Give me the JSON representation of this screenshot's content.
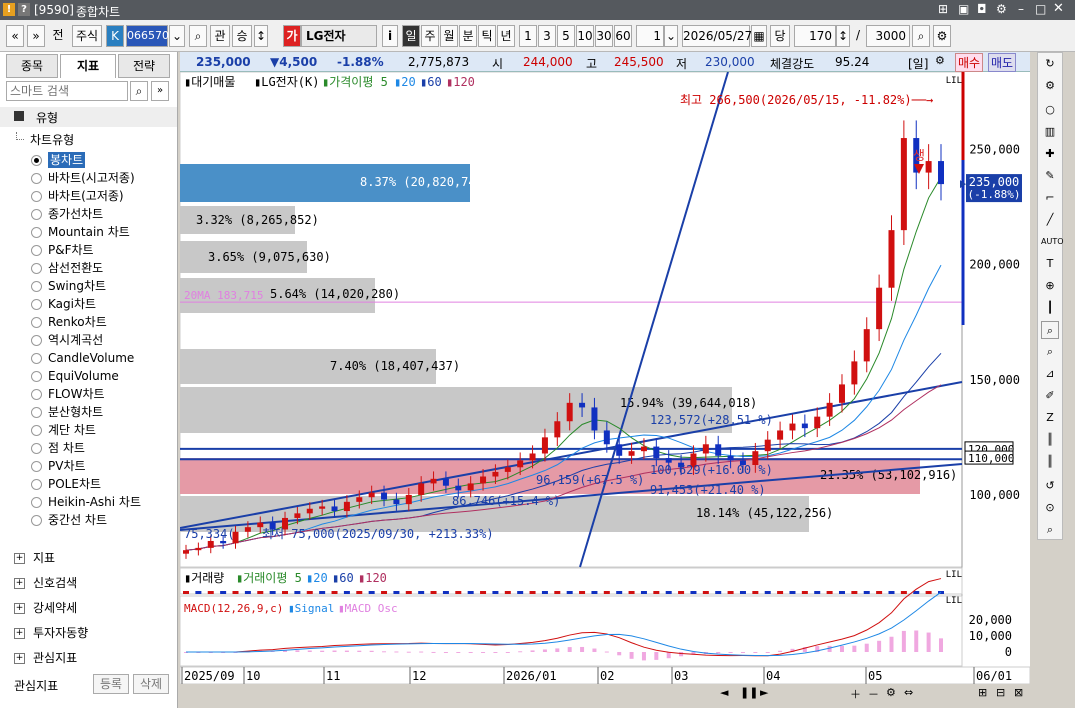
{
  "window": {
    "code": "[9590]",
    "title": "종합차트"
  },
  "toolbar": {
    "nav1": "«",
    "nav2": "»",
    "front": "전",
    "type": "주식",
    "kmark": "K",
    "code": "066570",
    "search": "⌕",
    "gwan": "관",
    "seung": "승",
    "stock_badge": "가",
    "stock_name": "LG전자",
    "info": "i",
    "periods": [
      "일",
      "주",
      "월",
      "분",
      "틱",
      "년"
    ],
    "nums": [
      "1",
      "3",
      "5",
      "10",
      "30",
      "60"
    ],
    "unit": "1",
    "date": "2026/05/27",
    "dang": "당",
    "count": "170",
    "slash": "/",
    "total": "3000"
  },
  "left": {
    "tabs": [
      "종목",
      "지표",
      "전략"
    ],
    "search_ph": "스마트 검색",
    "section_type": "유형",
    "chart_type_label": "차트유형",
    "types": [
      "봉차트",
      "바차트(시고저종)",
      "바차트(고저종)",
      "종가선차트",
      "Mountain 차트",
      "P&F차트",
      "삼선전환도",
      "Swing차트",
      "Kagi차트",
      "Renko차트",
      "역시계곡선",
      "CandleVolume",
      "EquiVolume",
      "FLOW차트",
      "분산형차트",
      "계단 차트",
      "점 차트",
      "PV차트",
      "POLE차트",
      "Heikin-Ashi 차트",
      "중간선 차트"
    ],
    "groups": [
      "지표",
      "신호검색",
      "강세약세",
      "투자자동향",
      "관심지표"
    ],
    "bottom": {
      "label": "관심지표",
      "reg": "등록",
      "del": "삭제"
    }
  },
  "quote": {
    "price": "235,000",
    "change": "▼4,500",
    "pct": "-1.88%",
    "volume": "2,775,873",
    "open_label": "시",
    "open": "244,000",
    "high_label": "고",
    "high": "245,500",
    "low_label": "저",
    "low": "230,000",
    "strength_label": "체결강도",
    "strength": "95.24",
    "period": "[일]",
    "buy": "매수",
    "sell": "매도"
  },
  "chart_data": {
    "type": "candlestick",
    "legend": {
      "main": "대기매물",
      "name": "LG전자(K)",
      "ma": "가격이평 5",
      "ma2": "20",
      "ma3": "60",
      "ma4": "120"
    },
    "y_ticks": [
      "250,000",
      "200,000",
      "150,000",
      "120,000",
      "110,000",
      "100,000"
    ],
    "x_ticks": [
      "2025/09",
      "10",
      "11",
      "12",
      "2026/01",
      "02",
      "03",
      "04",
      "05",
      "06/01"
    ],
    "current": "235,000",
    "current_pct": "(-1.88%)",
    "high_note": "최고 266,500(2026/05/15, -11.82%)",
    "low_note": "최저 75,000(2025/09/30, +213.33%)",
    "ma20_note": "20MA 183,715",
    "ref_left": "75,334(",
    "overlay_labels": [
      "8.37% (20,820,742)",
      "3.32% (8,265,852)",
      "3.65% (9,075,630)",
      "5.64% (14,020,280)",
      "7.40% (18,407,437)",
      "15.94% (39,644,018)",
      "21.35% (53,102,916)",
      "18.14% (45,122,256)"
    ],
    "fib_labels": [
      "123,572(+28.51 %)",
      "100,629(+16.00 %)",
      "91,453(+21.40 %)",
      "86,746(+15.4 %)",
      "96,159(+67.5 %)"
    ],
    "overlay_values": [
      8.37,
      3.32,
      3.65,
      5.64,
      7.4,
      15.94,
      21.35,
      18.14
    ],
    "sell_signal": "생",
    "vol_legend": {
      "name": "거래량",
      "ma": "거래이평 5",
      "ma2": "20",
      "ma3": "60",
      "ma4": "120"
    },
    "macd_legend": {
      "name": "MACD(12,26,9,c)",
      "signal": "Signal",
      "osc": "MACD Osc"
    },
    "macd_ticks": [
      "20,000",
      "10,000",
      "0"
    ],
    "ylim": [
      70000,
      275000
    ]
  }
}
